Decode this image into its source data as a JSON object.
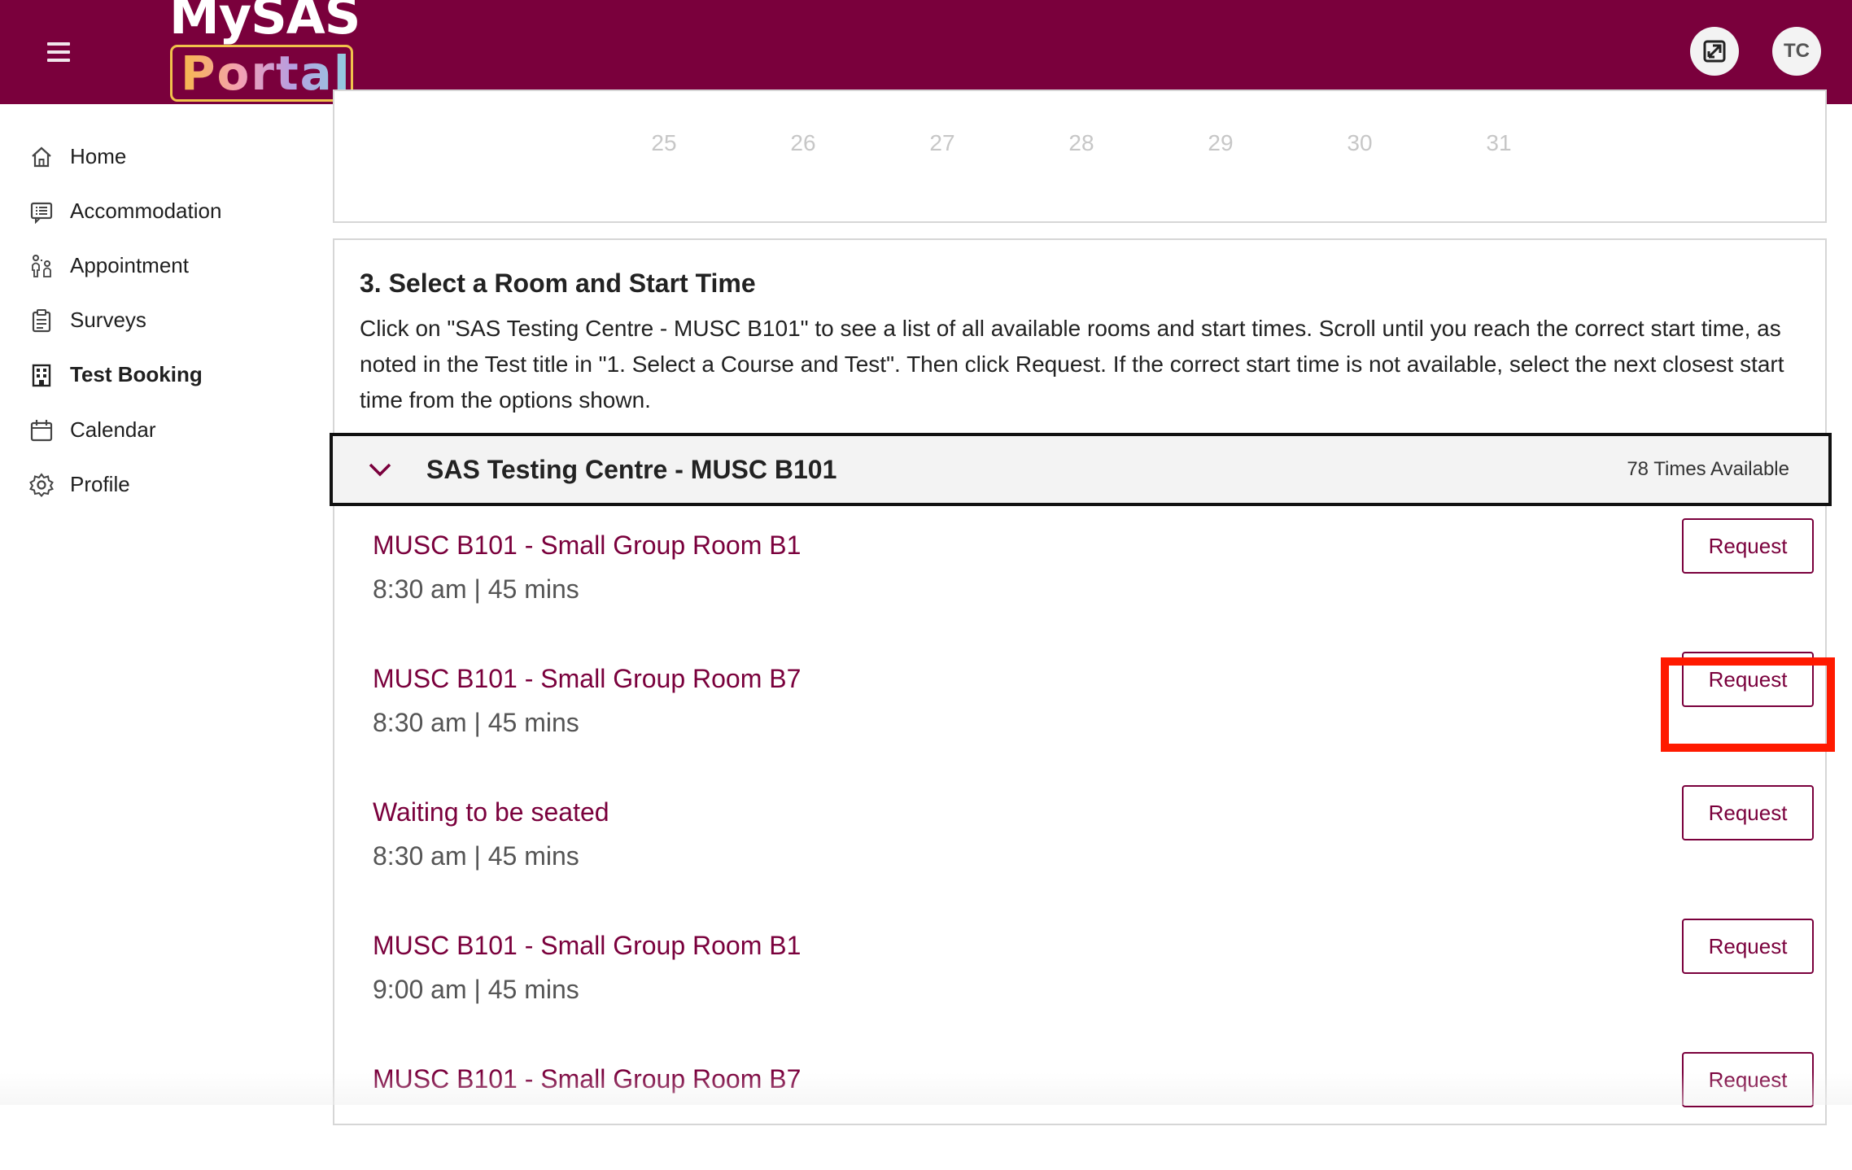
{
  "header": {
    "logo_top": "MySAS",
    "logo_bottom": "Portal",
    "avatar_initials": "TC",
    "brand_color": "#7a003c"
  },
  "sidebar": {
    "items": [
      {
        "label": "Home",
        "icon": "home-icon"
      },
      {
        "label": "Accommodation",
        "icon": "list-icon"
      },
      {
        "label": "Appointment",
        "icon": "people-icon"
      },
      {
        "label": "Surveys",
        "icon": "clipboard-icon"
      },
      {
        "label": "Test Booking",
        "icon": "building-icon",
        "active": true
      },
      {
        "label": "Calendar",
        "icon": "calendar-icon"
      },
      {
        "label": "Profile",
        "icon": "gear-icon"
      }
    ]
  },
  "calendar": {
    "days": [
      "25",
      "26",
      "27",
      "28",
      "29",
      "30",
      "31"
    ]
  },
  "section3": {
    "title": "3. Select a Room and Start Time",
    "description": "Click on \"SAS Testing Centre - MUSC B101\" to see a list of all available rooms and start times. Scroll until you reach the correct start time, as noted in the Test title in \"1. Select a Course and Test\". Then click Request. If the correct start time is not available, select the next closest start time from the options shown.",
    "accordion": {
      "title": "SAS Testing Centre - MUSC B101",
      "count": "78 Times Available"
    },
    "slots": [
      {
        "room": "MUSC B101 - Small Group Room B1",
        "time": "8:30 am | 45 mins",
        "button": "Request"
      },
      {
        "room": "MUSC B101 - Small Group Room B7",
        "time": "8:30 am | 45 mins",
        "button": "Request",
        "highlighted": true
      },
      {
        "room": "Waiting to be seated",
        "time": "8:30 am | 45 mins",
        "button": "Request"
      },
      {
        "room": "MUSC B101 - Small Group Room B1",
        "time": "9:00 am | 45 mins",
        "button": "Request"
      },
      {
        "room": "MUSC B101 - Small Group Room B7",
        "time": "",
        "button": "Request"
      }
    ]
  }
}
